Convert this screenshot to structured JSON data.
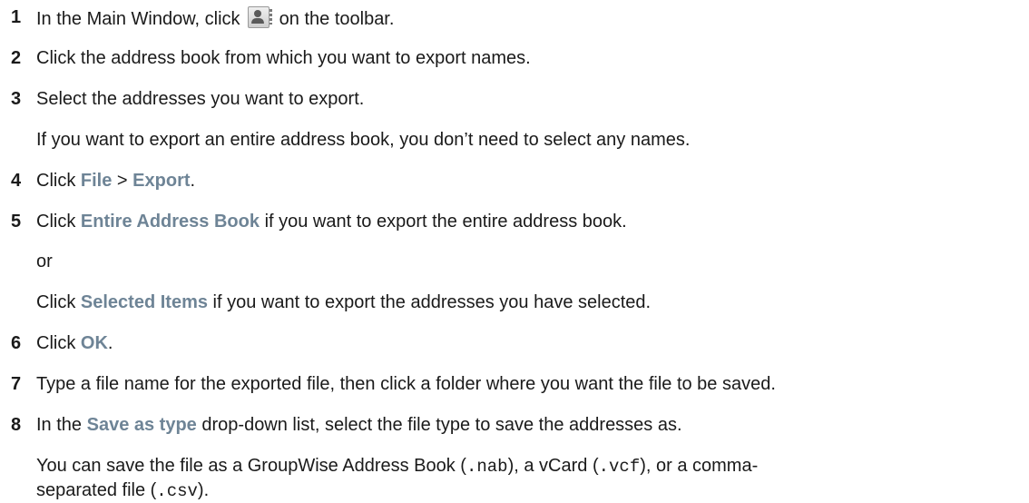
{
  "steps": [
    {
      "num": "1",
      "pre": "In the Main Window, click",
      "icon": "address-book-icon",
      "post": "on the toolbar."
    },
    {
      "num": "2",
      "text": "Click the address book from which you want to export names."
    },
    {
      "num": "3",
      "text": "Select the addresses you want to export.",
      "note": "If you want to export an entire address book, you don’t need to select any names."
    },
    {
      "num": "4",
      "pre": "Click",
      "ui1": "File",
      "sep": ">",
      "ui2": "Export",
      "post": "."
    },
    {
      "num": "5",
      "pre": "Click",
      "ui": "Entire Address Book",
      "post": "if you want to export the entire address book.",
      "or": "or",
      "alt_pre": "Click",
      "alt_ui": "Selected Items",
      "alt_post": "if you want to export the addresses you have selected."
    },
    {
      "num": "6",
      "pre": "Click",
      "ui": "OK",
      "post": "."
    },
    {
      "num": "7",
      "text": "Type a file name for the exported file, then click a folder where you want the file to be saved."
    },
    {
      "num": "8",
      "pre": "In the",
      "ui": "Save as type",
      "post": "drop-down list, select the file type to save the addresses as.",
      "note1_a": "You can save the file as a GroupWise Address Book (",
      "nab": ".nab",
      "note1_b": "), a vCard (",
      "vcf": ".vcf",
      "note1_c": "), or a comma-",
      "note2_a": "separated file (",
      "csv": ".csv",
      "note2_b": ")."
    }
  ]
}
